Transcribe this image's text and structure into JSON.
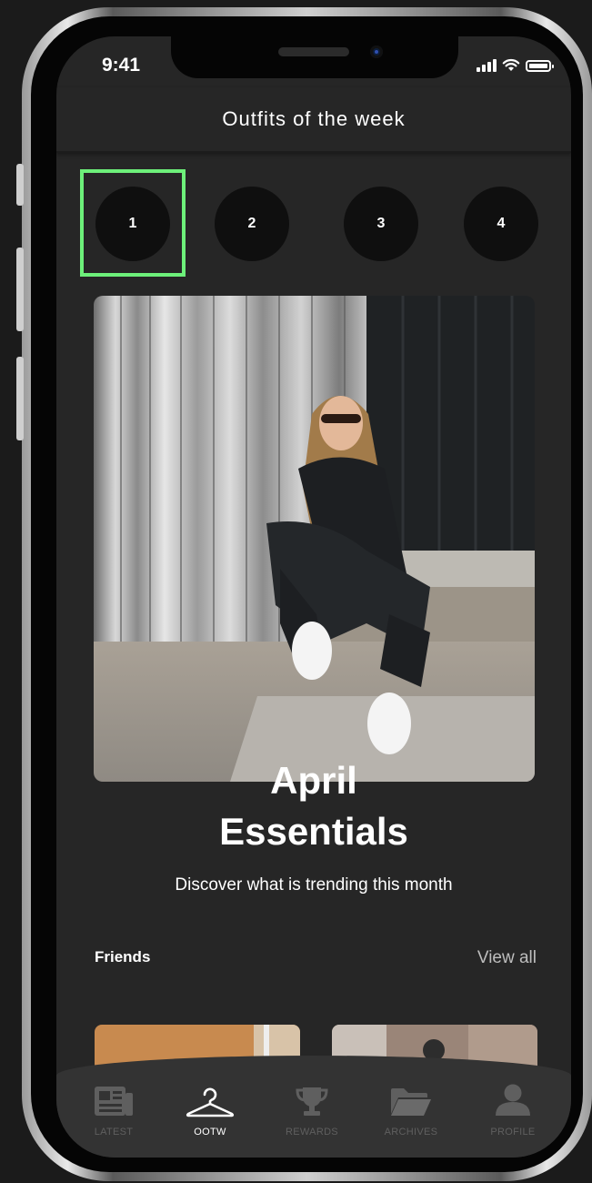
{
  "status_bar": {
    "time": "9:41"
  },
  "header": {
    "title": "Outfits of the week"
  },
  "weeks": [
    "1",
    "2",
    "3",
    "4"
  ],
  "hero": {
    "title_line1": "April",
    "title_line2": "Essentials",
    "subtitle": "Discover what is trending this month"
  },
  "friends": {
    "label": "Friends",
    "view_all": "View all"
  },
  "tabs": [
    {
      "label": "LATEST",
      "icon": "newspaper-icon"
    },
    {
      "label": "OOTW",
      "icon": "hanger-icon"
    },
    {
      "label": "REWARDS",
      "icon": "trophy-icon"
    },
    {
      "label": "ARCHIVES",
      "icon": "folder-icon"
    },
    {
      "label": "PROFILE",
      "icon": "user-icon"
    }
  ],
  "colors": {
    "background": "#1b1b1b",
    "screen": "#262626",
    "tabbar": "#333333",
    "selection_outline": "#6df07a",
    "inactive_tab": "#5f5f5f"
  }
}
